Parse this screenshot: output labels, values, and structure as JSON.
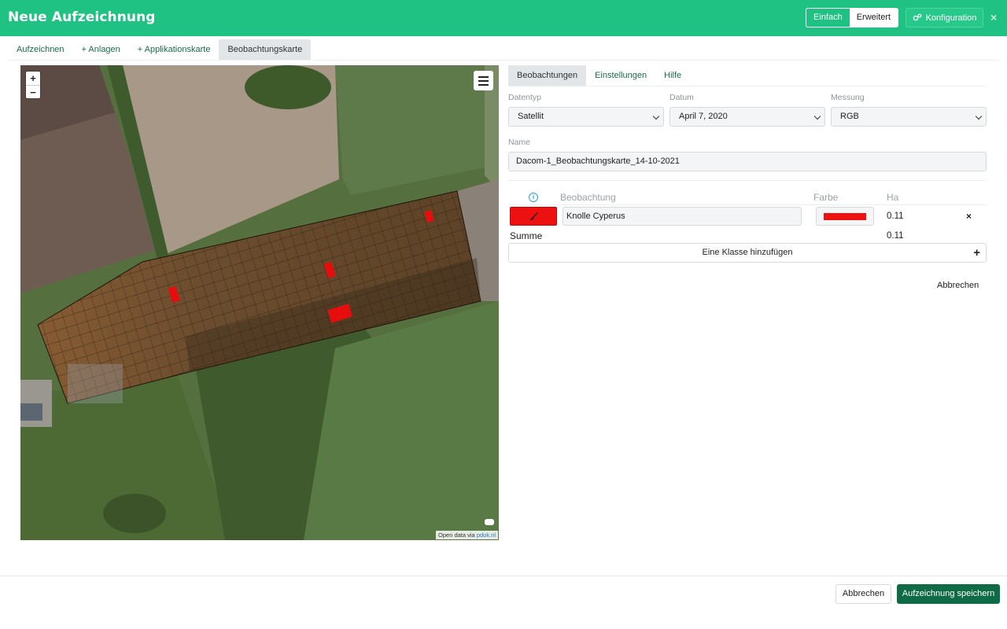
{
  "header": {
    "title": "Neue Aufzeichnung",
    "mode_simple": "Einfach",
    "mode_advanced": "Erweitert",
    "config_label": "Konfiguration",
    "close_glyph": "×"
  },
  "top_tabs": [
    {
      "label": "Aufzeichnen",
      "active": false
    },
    {
      "label": "+ Anlagen",
      "active": false
    },
    {
      "label": "+ Applikationskarte",
      "active": false
    },
    {
      "label": "Beobachtungskarte",
      "active": true
    }
  ],
  "map": {
    "zoom_in": "+",
    "zoom_out": "−",
    "attribution_prefix": "Open data via",
    "attribution_link": "pdok.nl"
  },
  "panel": {
    "tabs": [
      {
        "label": "Beobachtungen",
        "active": true
      },
      {
        "label": "Einstellungen",
        "active": false
      },
      {
        "label": "Hilfe",
        "active": false
      }
    ],
    "datentyp_label": "Datentyp",
    "datentyp_value": "Satellit",
    "datum_label": "Datum",
    "datum_value": "April 7, 2020",
    "messung_label": "Messung",
    "messung_value": "RGB",
    "name_label": "Name",
    "name_value": "Dacom-1_Beobachtungskarte_14-10-2021",
    "table": {
      "col_info": "i",
      "col_beobachtung": "Beobachtung",
      "col_farbe": "Farbe",
      "col_ha": "Ha",
      "rows": [
        {
          "beobachtung": "Knolle Cyperus",
          "color": "#ee1111",
          "ha": "0.11"
        }
      ],
      "summe_label": "Summe",
      "summe_value": "0.11"
    },
    "add_class_label": "Eine Klasse hinzufügen",
    "add_glyph": "+",
    "delete_glyph": "×",
    "cancel_link": "Abbrechen"
  },
  "footer": {
    "cancel_label": "Abbrechen",
    "save_label": "Aufzeichnung speichern"
  },
  "colors": {
    "brand": "#20c283",
    "save": "#0e6b46",
    "observation": "#ee1111"
  }
}
